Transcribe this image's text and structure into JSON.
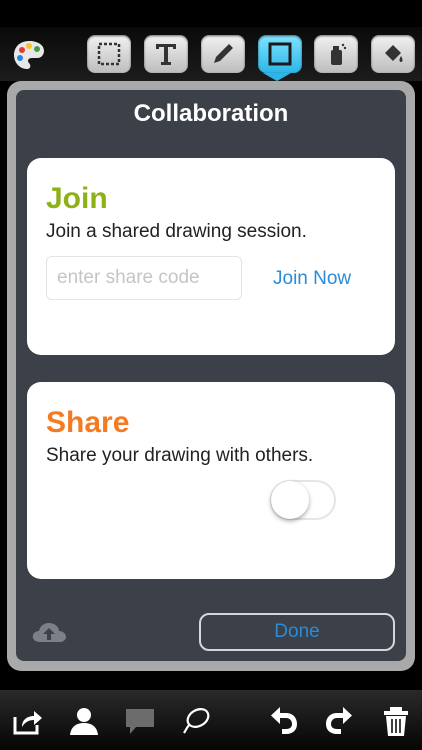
{
  "panel": {
    "title": "Collaboration"
  },
  "join": {
    "title": "Join",
    "description": "Join a shared drawing session.",
    "input_placeholder": "enter share code",
    "input_value": "",
    "action_label": "Join Now"
  },
  "share": {
    "title": "Share",
    "description": "Share your drawing with others.",
    "toggle_on": false
  },
  "footer": {
    "done_label": "Done"
  },
  "colors": {
    "join_accent": "#8db117",
    "share_accent": "#f47b22",
    "link_blue": "#2a8bd8",
    "active_tool": "#2cb6e8"
  },
  "top_toolbar": {
    "tools": [
      "palette-icon",
      "selection-icon",
      "text-icon",
      "pencil-icon",
      "shape-icon",
      "spray-icon",
      "fill-icon"
    ],
    "active_tool": "shape-icon"
  },
  "bottom_toolbar": {
    "tools": [
      "share-out-icon",
      "user-icon",
      "chat-icon",
      "lasso-icon",
      "undo-icon",
      "redo-icon",
      "trash-icon"
    ]
  }
}
